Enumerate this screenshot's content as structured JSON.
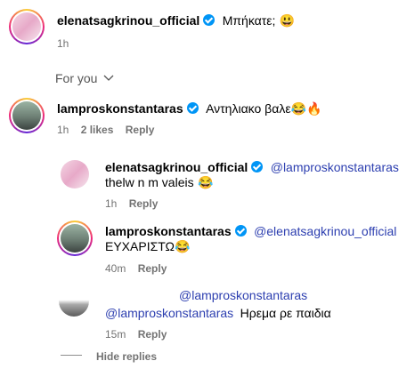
{
  "colors": {
    "text": "#000000",
    "muted": "#737373",
    "mention": "#2d3fb0",
    "verified": "#0095f6"
  },
  "top_comment": {
    "username": "elenatsagkrinou_official",
    "text": "Μπήκατε;",
    "emoji": "😃",
    "time": "1h"
  },
  "section": {
    "label": "For you",
    "chevron_icon": "chevron-down-icon"
  },
  "comment": {
    "username": "lamproskonstantaras",
    "text": "Αντηλιακο βαλε",
    "emoji": "😂🔥",
    "time": "1h",
    "likes": "2 likes",
    "reply_label": "Reply"
  },
  "replies": [
    {
      "username": "elenatsagkrinou_official",
      "mention": "@lamproskonstantaras",
      "text": "thelw n m valeis",
      "emoji": "😂",
      "time": "1h",
      "reply_label": "Reply"
    },
    {
      "username": "lamproskonstantaras",
      "mention": "@elenatsagkrinou_official",
      "text": "ΕΥΧΑΡΙΣΤΩ",
      "emoji": "😂",
      "time": "40m",
      "reply_label": "Reply"
    },
    {
      "mention_line1": "@lamproskonstantaras",
      "mention_line2": "@lamproskonstantaras",
      "text": "Ηρεμα ρε παιδια",
      "time": "15m",
      "reply_label": "Reply"
    }
  ],
  "hide_replies_label": "Hide replies"
}
